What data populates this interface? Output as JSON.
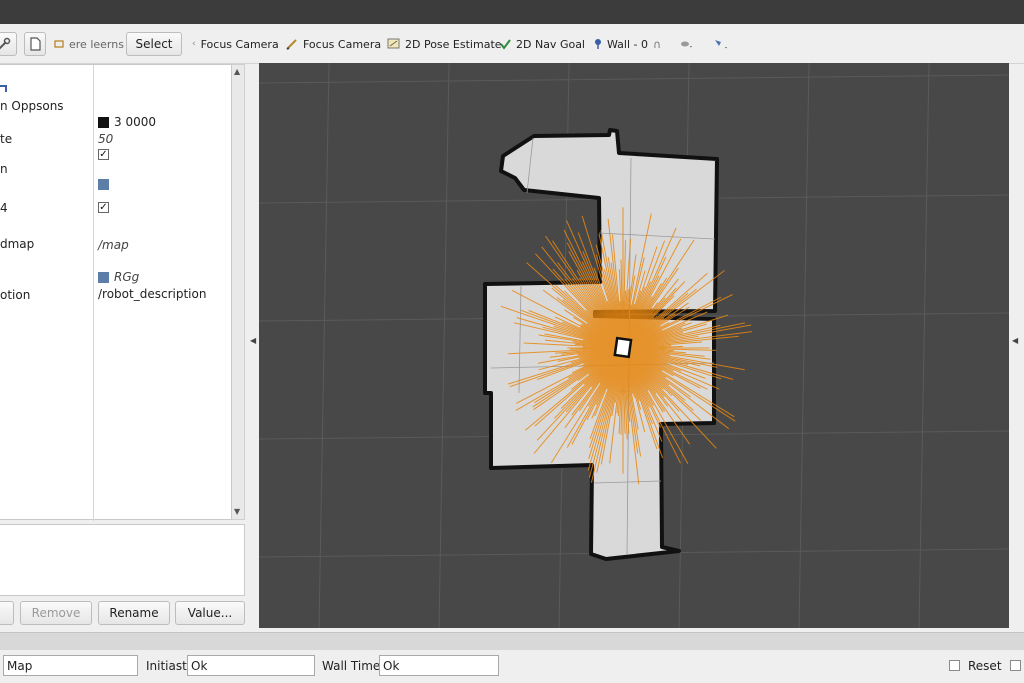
{
  "toolbar": {
    "interact_label": "ere leerns",
    "select_label": "Select",
    "focus_camera_1": "Focus Camera",
    "focus_camera_2": "Focus Camera",
    "pose_estimate": "2D Pose Estimate",
    "nav_goal": "2D Nav Goal",
    "wall": "Wall - 0"
  },
  "properties": [
    {
      "name": "n Oppsons",
      "value": "",
      "kind": "text"
    },
    {
      "name": "",
      "value": "3 0000",
      "kind": "color",
      "color": "#111111"
    },
    {
      "name": "te",
      "value": "50",
      "kind": "italic"
    },
    {
      "name": "n",
      "value": "",
      "kind": "check"
    },
    {
      "name": "",
      "value": "",
      "kind": "color-only",
      "color": "#5c7ea8"
    },
    {
      "name": "4",
      "value": "",
      "kind": "check"
    },
    {
      "name": "dmap",
      "value": "/map",
      "kind": "italic"
    },
    {
      "name": "",
      "value": "RGg",
      "kind": "color-italic",
      "color": "#5c7ea8"
    },
    {
      "name": "otion",
      "value": "/robot_description",
      "kind": "text"
    }
  ],
  "panel_buttons": {
    "remove": "Remove",
    "rename": "Rename",
    "value": "Value..."
  },
  "status": {
    "fixed_frame_value": "Map",
    "initiast_label": "Initiast:",
    "initiast_value": "Ok",
    "wall_time_label": "Wall Time:",
    "wall_time_value": "Ok",
    "reset_label": "Reset"
  },
  "colors": {
    "viewport_bg": "#484848",
    "map_free": "#d9d9d9",
    "laser": "#e8870f"
  }
}
